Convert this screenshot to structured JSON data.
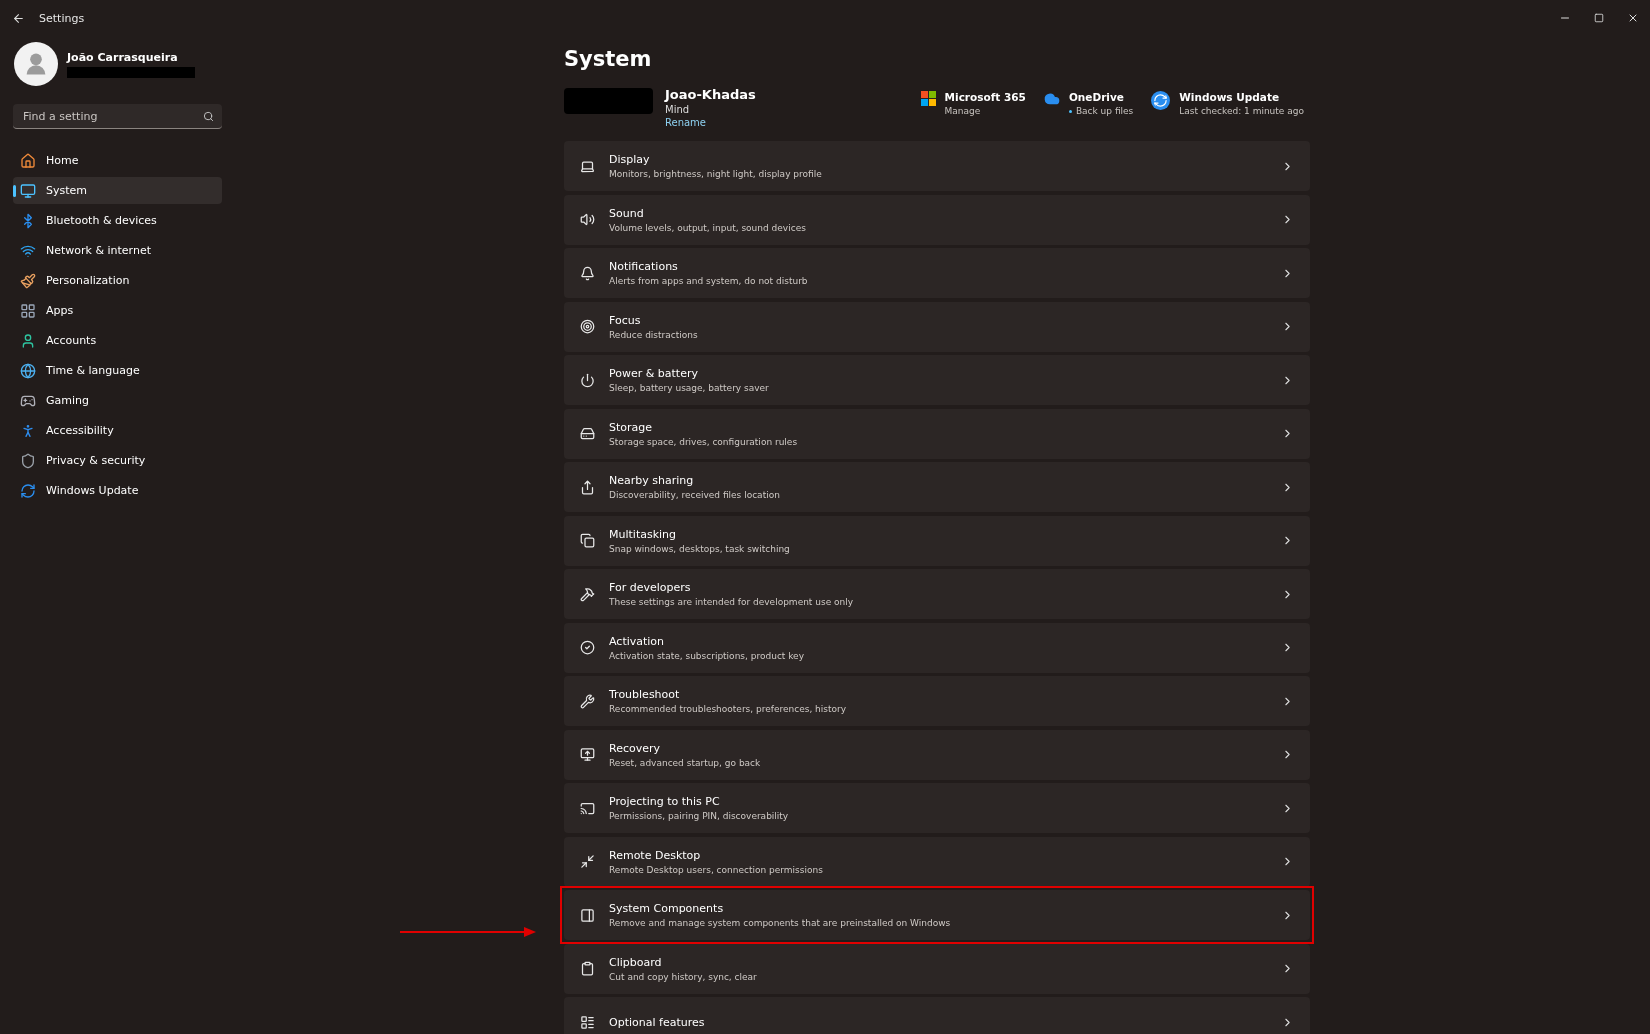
{
  "window": {
    "title": "Settings"
  },
  "user": {
    "name": "João Carrasqueira"
  },
  "search": {
    "placeholder": "Find a setting"
  },
  "nav": [
    {
      "label": "Home",
      "selected": false
    },
    {
      "label": "System",
      "selected": true
    },
    {
      "label": "Bluetooth & devices",
      "selected": false
    },
    {
      "label": "Network & internet",
      "selected": false
    },
    {
      "label": "Personalization",
      "selected": false
    },
    {
      "label": "Apps",
      "selected": false
    },
    {
      "label": "Accounts",
      "selected": false
    },
    {
      "label": "Time & language",
      "selected": false
    },
    {
      "label": "Gaming",
      "selected": false
    },
    {
      "label": "Accessibility",
      "selected": false
    },
    {
      "label": "Privacy & security",
      "selected": false
    },
    {
      "label": "Windows Update",
      "selected": false
    }
  ],
  "page": {
    "title": "System"
  },
  "device": {
    "name": "Joao-Khadas",
    "model": "Mind",
    "rename": "Rename"
  },
  "services": [
    {
      "title": "Microsoft 365",
      "subtitle": "Manage",
      "dot": false
    },
    {
      "title": "OneDrive",
      "subtitle": "Back up files",
      "dot": true
    },
    {
      "title": "Windows Update",
      "subtitle": "Last checked: 1 minute ago",
      "dot": false
    }
  ],
  "items": [
    {
      "title": "Display",
      "subtitle": "Monitors, brightness, night light, display profile",
      "highlighted": false
    },
    {
      "title": "Sound",
      "subtitle": "Volume levels, output, input, sound devices",
      "highlighted": false
    },
    {
      "title": "Notifications",
      "subtitle": "Alerts from apps and system, do not disturb",
      "highlighted": false
    },
    {
      "title": "Focus",
      "subtitle": "Reduce distractions",
      "highlighted": false
    },
    {
      "title": "Power & battery",
      "subtitle": "Sleep, battery usage, battery saver",
      "highlighted": false
    },
    {
      "title": "Storage",
      "subtitle": "Storage space, drives, configuration rules",
      "highlighted": false
    },
    {
      "title": "Nearby sharing",
      "subtitle": "Discoverability, received files location",
      "highlighted": false
    },
    {
      "title": "Multitasking",
      "subtitle": "Snap windows, desktops, task switching",
      "highlighted": false
    },
    {
      "title": "For developers",
      "subtitle": "These settings are intended for development use only",
      "highlighted": false
    },
    {
      "title": "Activation",
      "subtitle": "Activation state, subscriptions, product key",
      "highlighted": false
    },
    {
      "title": "Troubleshoot",
      "subtitle": "Recommended troubleshooters, preferences, history",
      "highlighted": false
    },
    {
      "title": "Recovery",
      "subtitle": "Reset, advanced startup, go back",
      "highlighted": false
    },
    {
      "title": "Projecting to this PC",
      "subtitle": "Permissions, pairing PIN, discoverability",
      "highlighted": false
    },
    {
      "title": "Remote Desktop",
      "subtitle": "Remote Desktop users, connection permissions",
      "highlighted": false
    },
    {
      "title": "System Components",
      "subtitle": "Remove and manage system components that are preinstalled on Windows",
      "highlighted": true
    },
    {
      "title": "Clipboard",
      "subtitle": "Cut and copy history, sync, clear",
      "highlighted": false
    },
    {
      "title": "Optional features",
      "highlighted": false
    }
  ]
}
